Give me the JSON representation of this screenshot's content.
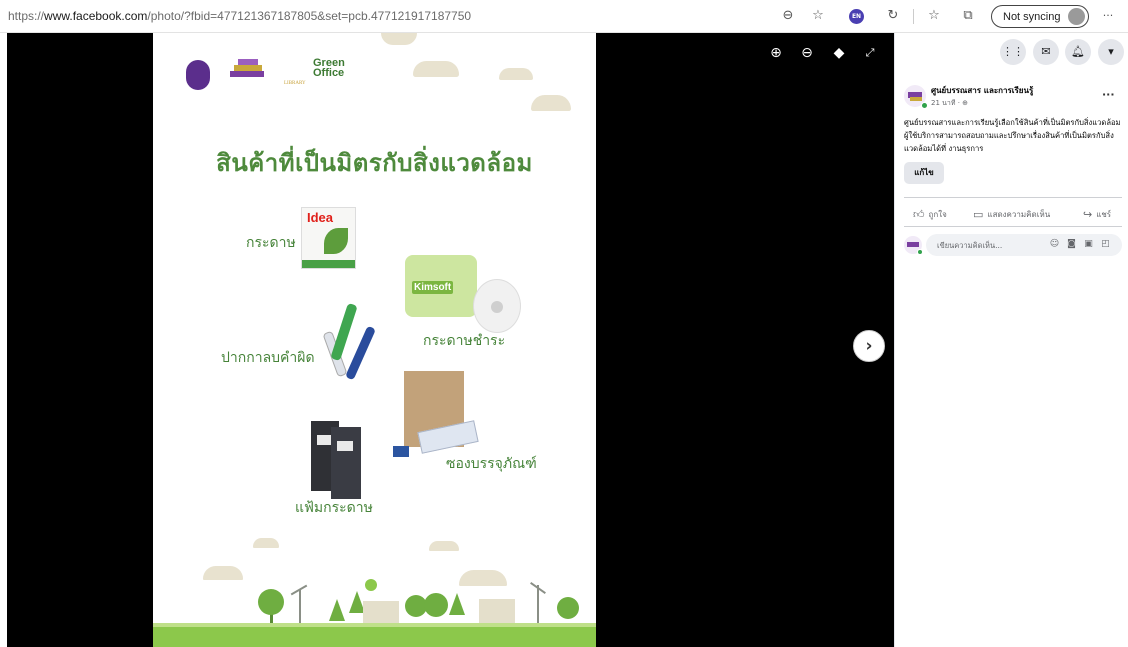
{
  "browser": {
    "url_prefix": "https://",
    "url_host": "www.facebook.com",
    "url_rest": "/photo/?fbid=477121367187805&set=pcb.477121917187750",
    "zoom_icon": "zoom-out-icon",
    "profile_badge": "EN",
    "sync_label": "Not syncing",
    "more_label": "···"
  },
  "photo": {
    "headline": "สินค้าที่เป็นมิตรกับสิ่งแวดล้อม",
    "logo_library": "LIBRARY",
    "logo_green_1": "Green",
    "logo_green_2": "Office",
    "paper_brand": "Idea",
    "tissue_brand": "Kimsoft",
    "items": {
      "paper": "กระดาษ",
      "tissue": "กระดาษชำระ",
      "pen": "ปากกาลบคำผิด",
      "envelope": "ซองบรรจุภัณฑ์",
      "folder": "แฟ้มกระดาษ"
    }
  },
  "viewer": {
    "next_symbol": "›"
  },
  "post": {
    "page_name": "ศูนย์บรรณสาร และการเรียนรู้",
    "time": "21 นาที · ⊕",
    "more": "···",
    "text": "ศูนย์บรรณสารและการเรียนรู้เลือกใช้สินค้าที่เป็นมิตรกับสิ่งแวดล้อม ผู้ใช้บริการสามารถสอบถามและปรึกษาเรื่องสินค้าที่เป็นมิตรกับสิ่งแวดล้อมได้ที่ งานธุรการ",
    "edit_label": "แก้ไข",
    "like_label": "ถูกใจ",
    "comment_label": "แสดงความคิดเห็น",
    "share_label": "แชร์",
    "comment_placeholder": "เขียนความคิดเห็น..."
  }
}
